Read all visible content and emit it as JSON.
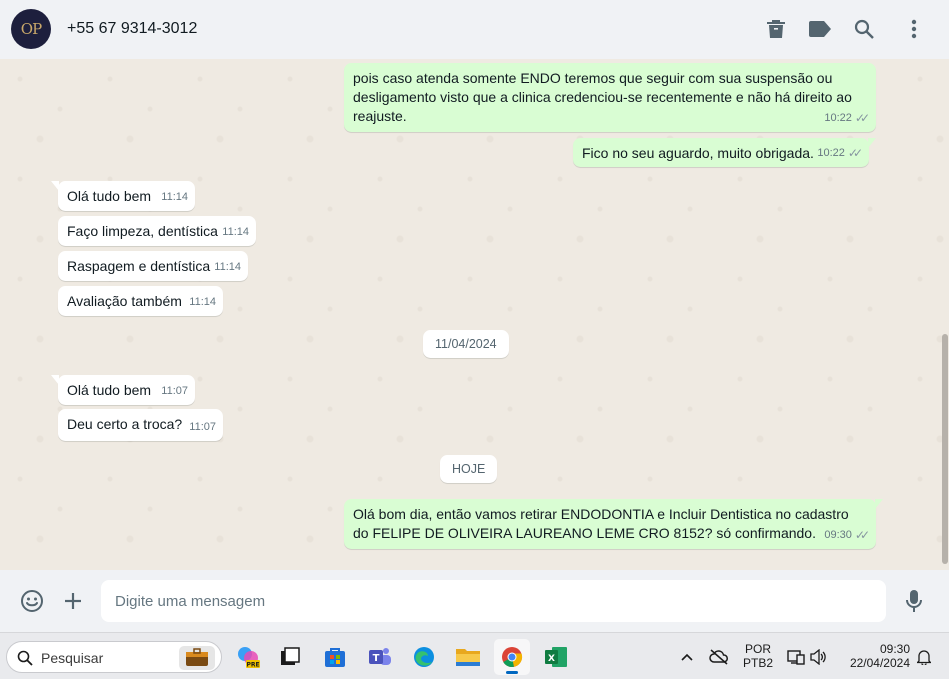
{
  "header": {
    "avatar_initials": "OP",
    "contact_name": "+55 67 9314-3012",
    "icons": [
      "delete-icon",
      "label-icon",
      "search-icon",
      "menu-icon"
    ]
  },
  "messages": [
    {
      "dir": "out",
      "text": "pois caso atenda somente ENDO teremos que seguir com sua suspensão ou desligamento visto que a clinica credenciou-se recentemente e não há direito ao reajuste.",
      "time": "10:22"
    },
    {
      "dir": "out",
      "text": "Fico no seu aguardo, muito obrigada.",
      "time": "10:22"
    },
    {
      "dir": "in",
      "text": "Olá tudo bem",
      "time": "11:14"
    },
    {
      "dir": "in",
      "text": "Faço limpeza, dentística",
      "time": "11:14"
    },
    {
      "dir": "in",
      "text": "Raspagem e dentística",
      "time": "11:14"
    },
    {
      "dir": "in",
      "text": "Avaliação também",
      "time": "11:14"
    },
    {
      "dir": "in",
      "text": "Olá tudo bem",
      "time": "11:07"
    },
    {
      "dir": "in",
      "text": "Deu certo a troca?",
      "time": "11:07"
    },
    {
      "dir": "out",
      "text": "Olá bom dia, então vamos retirar ENDODONTIA e Incluir Dentistica no cadastro do FELIPE DE OLIVEIRA LAUREANO LEME  CRO 8152? só confirmando.",
      "time": "09:30"
    }
  ],
  "dates": {
    "date1": "11/04/2024",
    "date2": "HOJE"
  },
  "compose": {
    "placeholder": "Digite uma mensagem"
  },
  "taskbar": {
    "search_label": "Pesquisar",
    "copilot_badge": "PRE",
    "language_top": "POR",
    "language_bottom": "PTB2",
    "time": "09:30",
    "date": "22/04/2024"
  },
  "colors": {
    "outgoing_bubble": "#d9fdd3",
    "incoming_bubble": "#ffffff",
    "chat_bg": "#efeae2",
    "header_bg": "#f0f2f5"
  }
}
